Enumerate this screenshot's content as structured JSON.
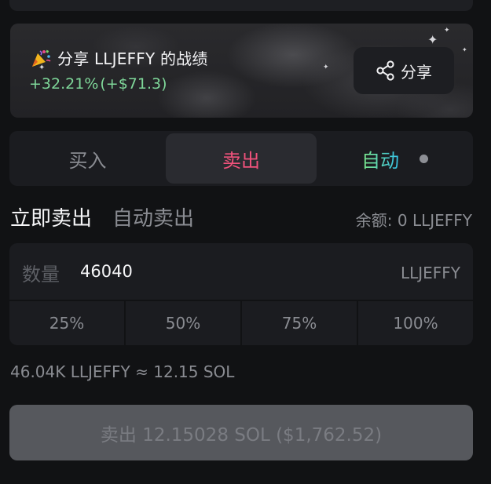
{
  "banner": {
    "title": "分享 LLJEFFY 的战绩",
    "pnl_percent": "+32.21%",
    "pnl_value": "(+$71.3)",
    "share_label": "分享",
    "party_icon": "party-popper-icon",
    "share_icon": "share-nodes-icon"
  },
  "mode_tabs": {
    "buy": "买入",
    "sell": "卖出",
    "auto": "自动",
    "active": "sell"
  },
  "sell_modes": {
    "instant": "立即卖出",
    "auto": "自动卖出",
    "active": "instant"
  },
  "balance": "余额: 0 LLJEFFY",
  "amount": {
    "label": "数量",
    "value": "46040",
    "unit": "LLJEFFY"
  },
  "percent_buttons": [
    "25%",
    "50%",
    "75%",
    "100%"
  ],
  "conversion": "46.04K LLJEFFY ≈ 12.15 SOL",
  "submit_label": "卖出 12.15028 SOL ($1,762.52)",
  "colors": {
    "background": "#111214",
    "panel": "#1b1c20",
    "sell_accent": "#f0527b",
    "profit_green": "#7fd89a",
    "auto_gradient_start": "#7ee787",
    "auto_gradient_end": "#35c2e8",
    "submit_disabled": "#56585d"
  }
}
